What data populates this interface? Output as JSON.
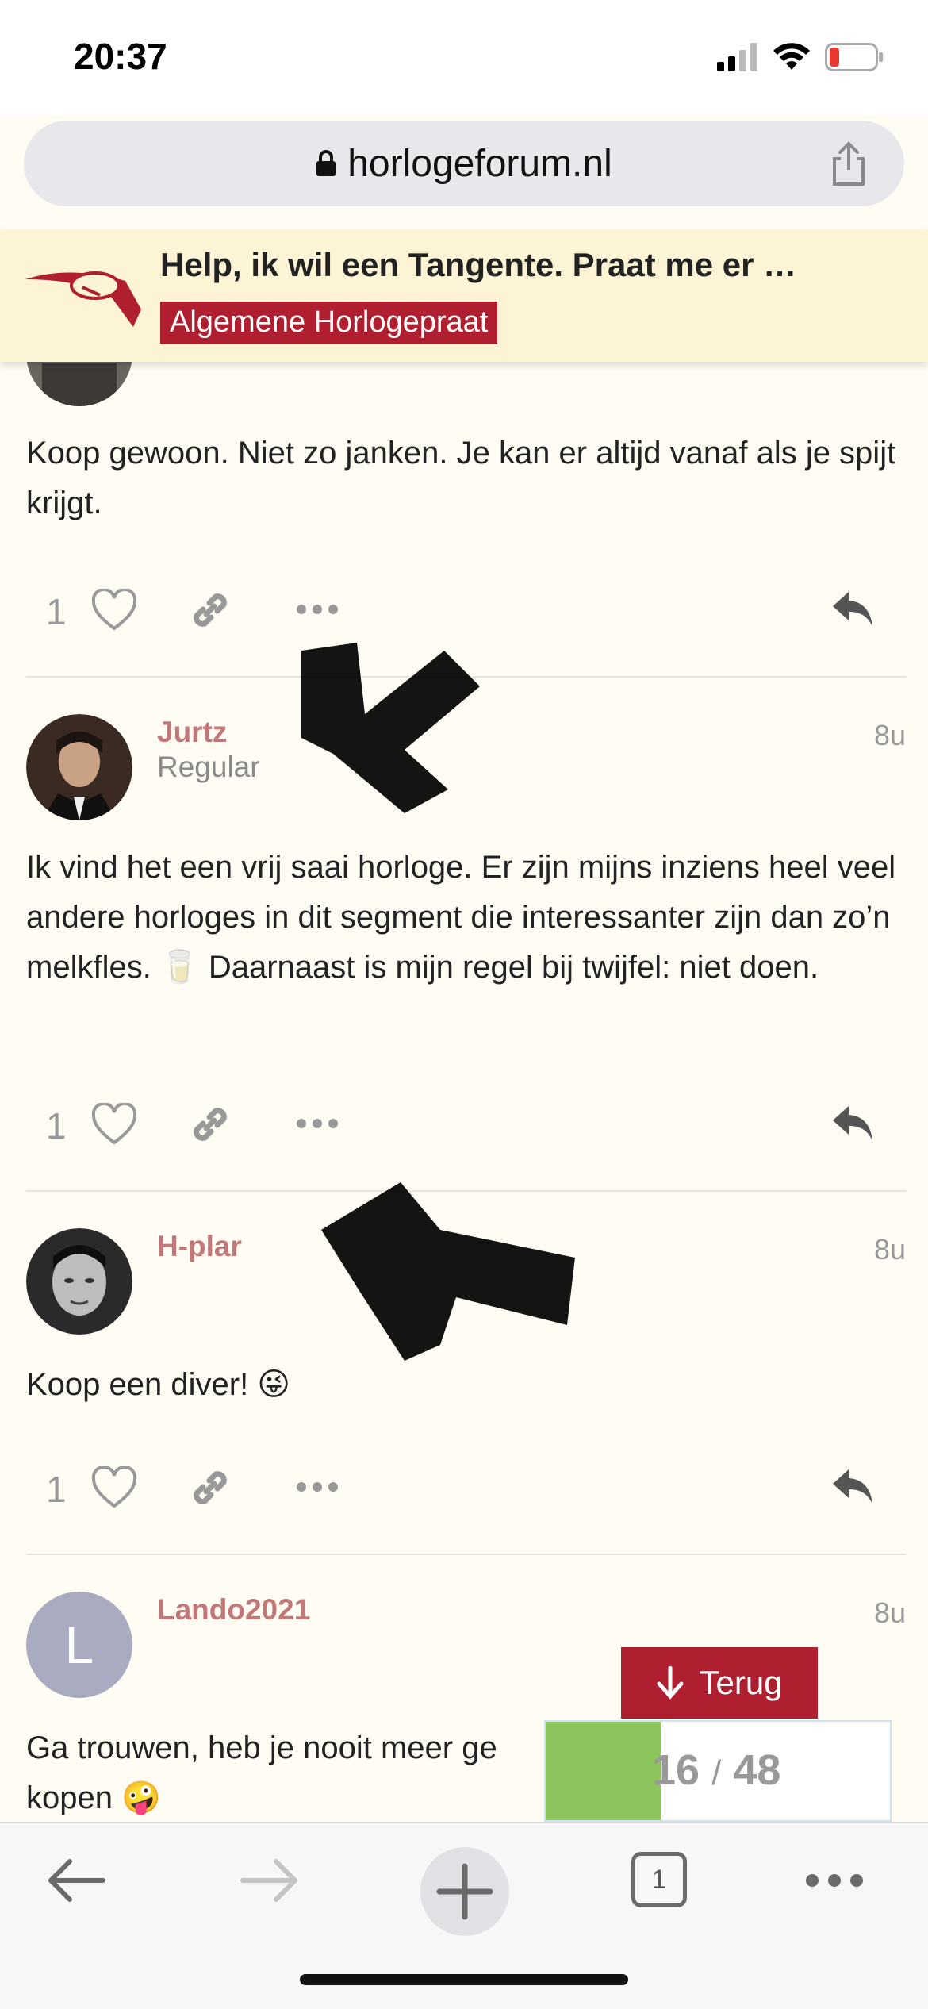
{
  "status_bar": {
    "time": "20:37"
  },
  "browser": {
    "url": "horlogeforum.nl"
  },
  "topic": {
    "title": "Help, ik wil een Tangente. Praat me er …",
    "category": "Algemene Horlogepraat"
  },
  "posts": [
    {
      "text": "Koop gewoon. Niet zo janken. Je kan er altijd vanaf als je spijt krijgt.",
      "likes": "1"
    },
    {
      "username": "Jurtz",
      "usertitle": "Regular",
      "date": "8u",
      "text": "Ik vind het een vrij saai horloge. Er zijn mijns inziens heel veel andere horloges in dit segment die interessanter zijn dan zo’n melkfles. 🥛 Daarnaast is mijn regel bij twijfel: niet doen.",
      "likes": "1"
    },
    {
      "username": "H-plar",
      "date": "8u",
      "text": "Koop een diver! 😜",
      "likes": "1"
    },
    {
      "username": "Lando2021",
      "avatar_letter": "L",
      "date": "8u",
      "text": "Ga trouwen, heb je nooit meer ge",
      "text_line2": "kopen 🤪"
    }
  ],
  "timeline": {
    "back_label": "Terug",
    "current": "16",
    "separator": "/",
    "total": "48",
    "progress_fraction": 0.3333
  },
  "toolbar": {
    "tab_count": "1"
  },
  "colors": {
    "accent": "#b01f2f",
    "header_bg": "#fcf4d4",
    "page_bg": "#fffdf3",
    "username": "#c27878",
    "progress": "#8dc55d"
  },
  "icons": [
    "lock-icon",
    "share-icon",
    "heart-icon",
    "link-icon",
    "more-icon",
    "reply-icon",
    "back-arrow-icon",
    "forward-arrow-icon",
    "plus-icon",
    "tabs-icon",
    "ellipsis-icon"
  ]
}
